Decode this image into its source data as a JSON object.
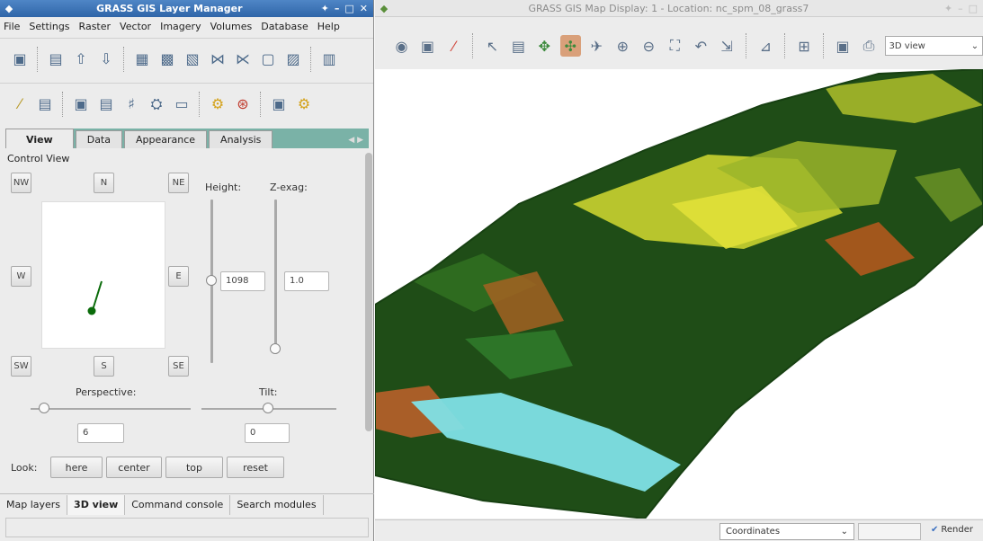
{
  "layer_manager": {
    "title": "GRASS GIS Layer Manager",
    "window_controls": [
      "✦",
      "–",
      "□",
      "✕"
    ],
    "menu": [
      "File",
      "Settings",
      "Raster",
      "Vector",
      "Imagery",
      "Volumes",
      "Database",
      "Help"
    ],
    "nviz_tabs": [
      "View",
      "Data",
      "Appearance",
      "Analysis"
    ],
    "control_view_label": "Control View",
    "directions": {
      "nw": "NW",
      "n": "N",
      "ne": "NE",
      "w": "W",
      "e": "E",
      "sw": "SW",
      "s": "S",
      "se": "SE"
    },
    "height_label": "Height:",
    "zexag_label": "Z-exag:",
    "height_value": "1098",
    "zexag_value": "1.0",
    "perspective_label": "Perspective:",
    "tilt_label": "Tilt:",
    "perspective_value": "6",
    "tilt_value": "0",
    "look_label": "Look:",
    "look_buttons": [
      "here",
      "center",
      "top",
      "reset"
    ],
    "bottom_tabs": [
      "Map layers",
      "3D view",
      "Command console",
      "Search modules"
    ],
    "active_bottom_tab": "3D view"
  },
  "map_display": {
    "title": "GRASS GIS Map Display: 1  - Location: nc_spm_08_grass7",
    "view_mode": "3D view",
    "status_select": "Coordinates",
    "render_label": "Render",
    "render_checked": true
  },
  "colors": {
    "lm_title": "#2f65a8",
    "tab_strip": "#7ab2a7",
    "terrain_forest": "#1e4d16",
    "terrain_field": "#d8dd2c",
    "water": "#7fe0e6"
  }
}
